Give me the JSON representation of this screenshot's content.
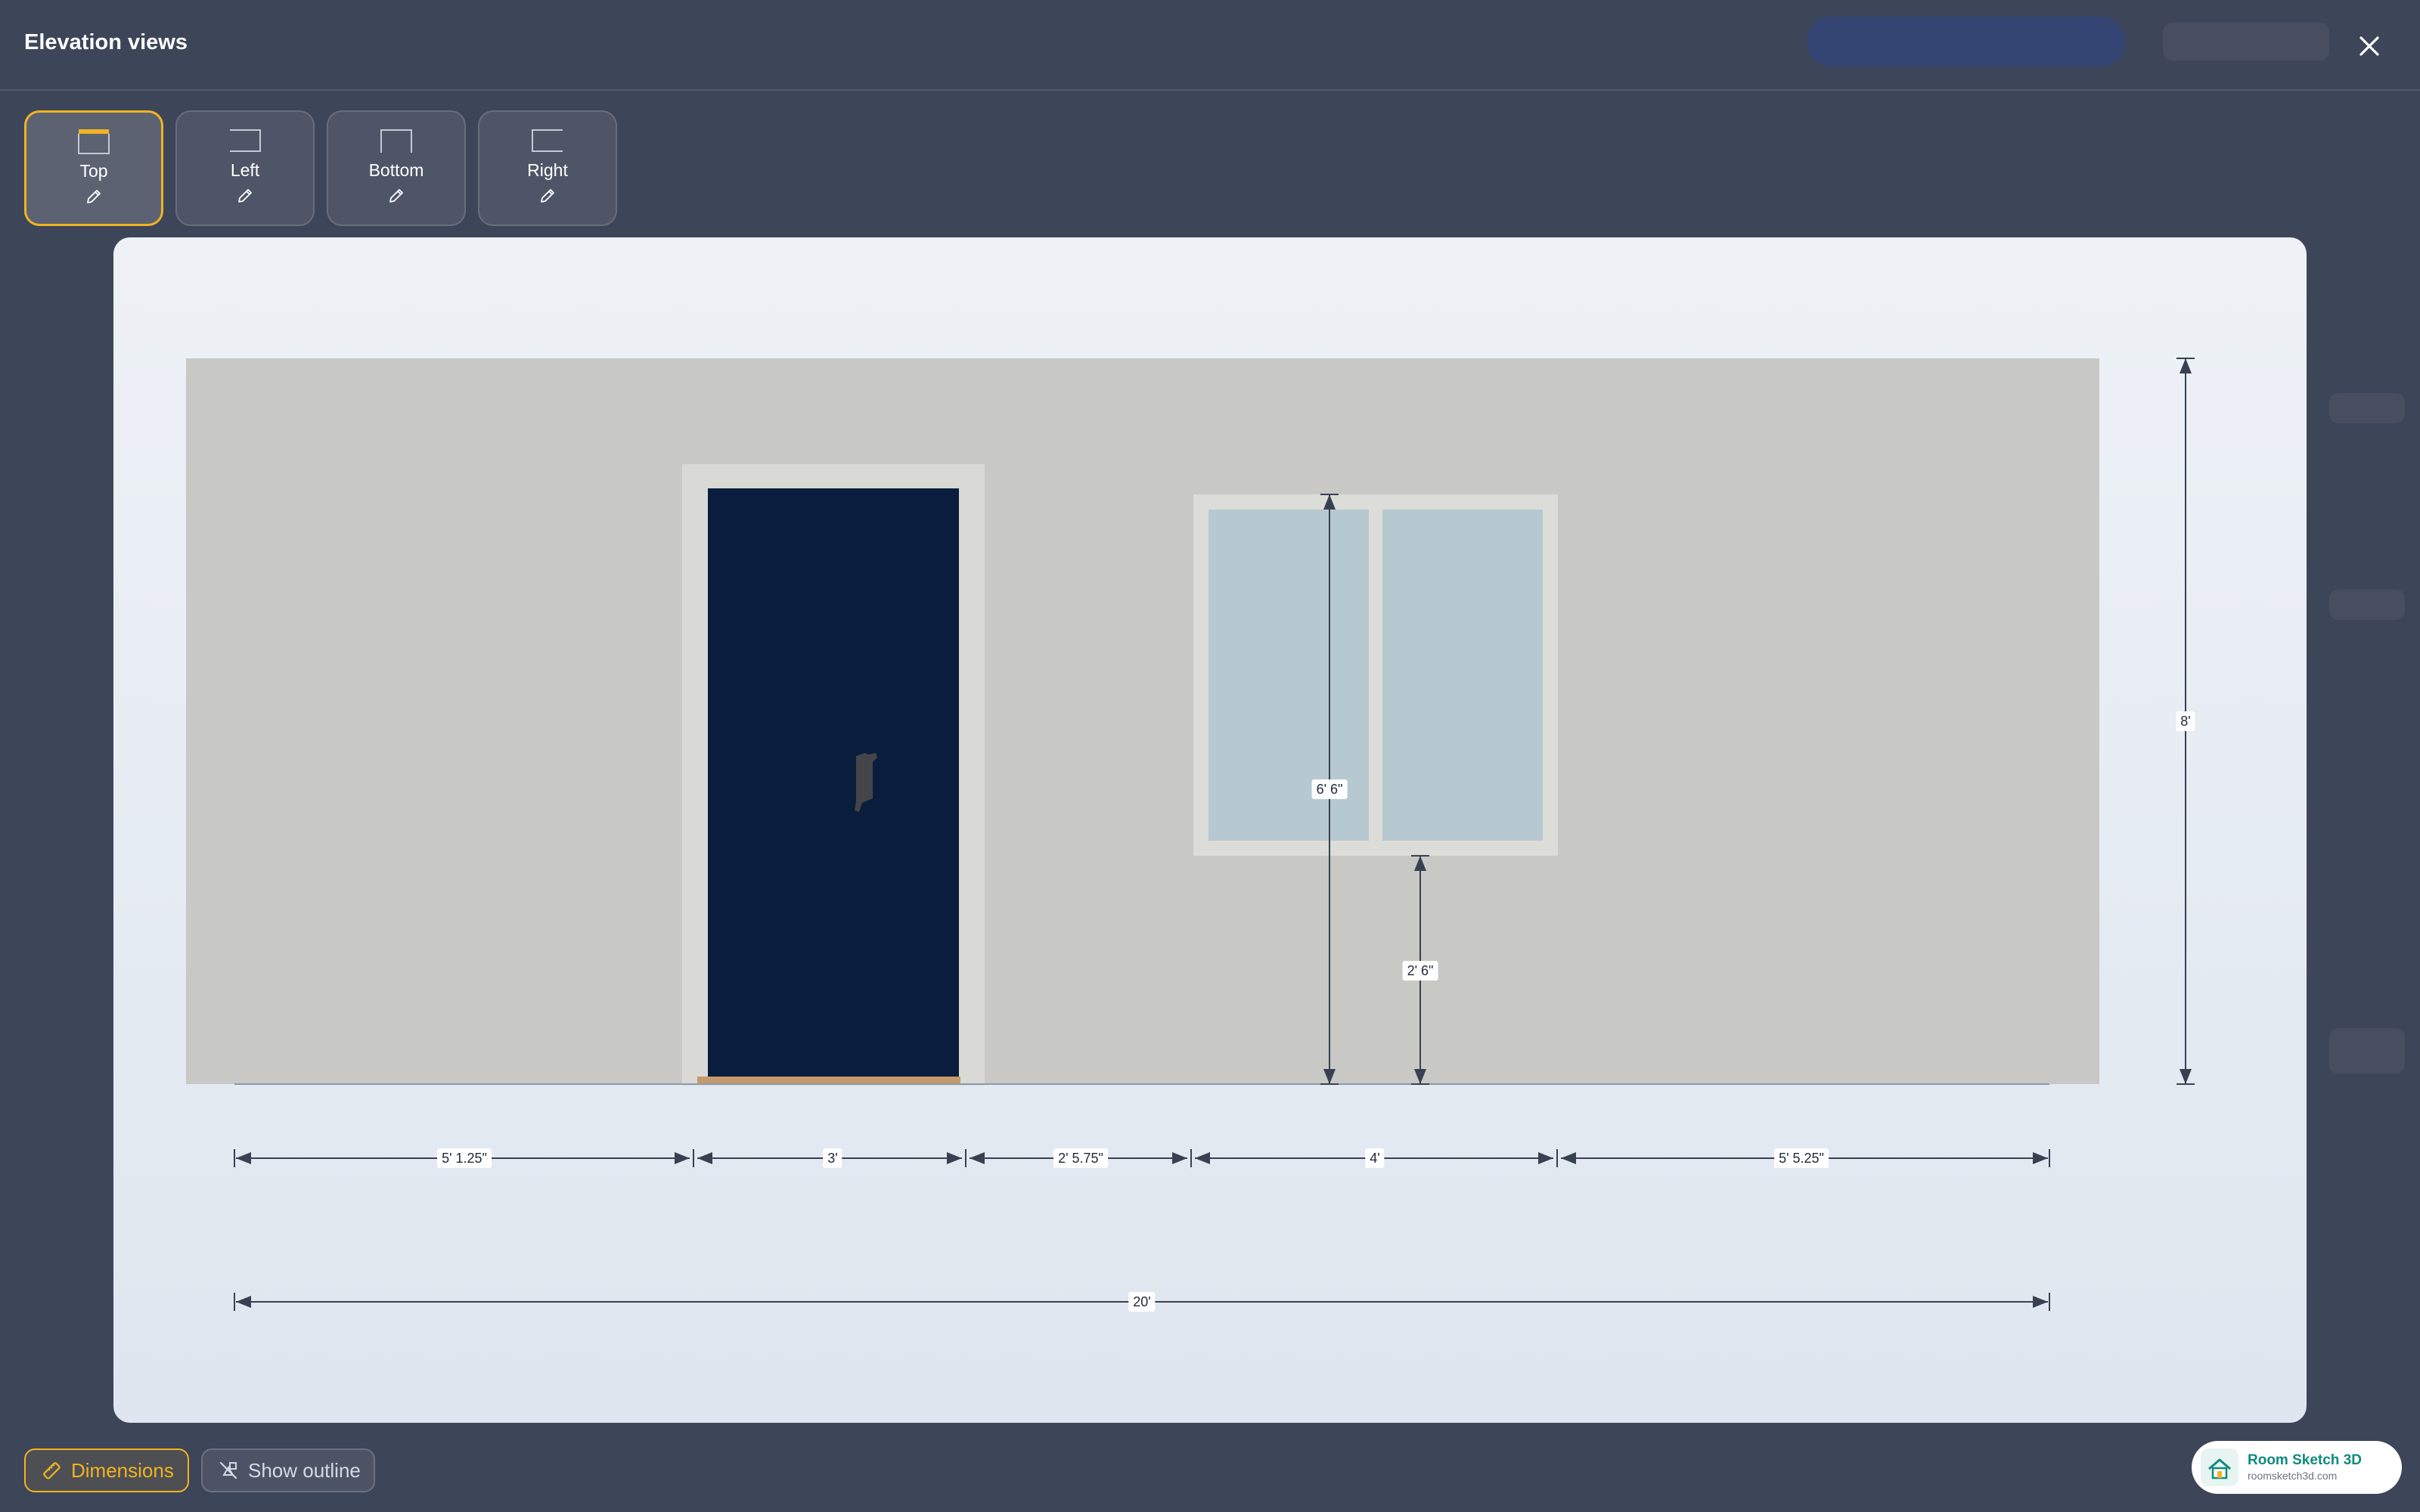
{
  "modal": {
    "title": "Elevation views",
    "close_icon": "close-icon"
  },
  "view_tabs": [
    {
      "label": "Top",
      "icon": "wall-top-icon",
      "active": true
    },
    {
      "label": "Left",
      "icon": "wall-left-icon",
      "active": false
    },
    {
      "label": "Bottom",
      "icon": "wall-bottom-icon",
      "active": false
    },
    {
      "label": "Right",
      "icon": "wall-right-icon",
      "active": false
    }
  ],
  "elevation": {
    "dimensions": {
      "wall_height": "8'",
      "window_height": "6' 6\"",
      "sill_height": "2' 6\"",
      "segments": [
        "5' 1.25\"",
        "3'",
        "2' 5.75\"",
        "4'",
        "5' 5.25\""
      ],
      "total_width": "20'"
    },
    "colors": {
      "wall": "#c8c8c5",
      "door": "#0b1d3d",
      "door_frame": "#d9dad6",
      "door_threshold": "#c49a6c",
      "window_glass": "#b7c9d0",
      "window_frame": "#dcdcd8",
      "dimension_line": "#374151"
    }
  },
  "footer": {
    "dimensions_label": "Dimensions",
    "show_outline_label": "Show outline",
    "brand_name": "Room Sketch 3D",
    "brand_url": "roomsketch3d.com",
    "accent_color": "#f0b323"
  }
}
